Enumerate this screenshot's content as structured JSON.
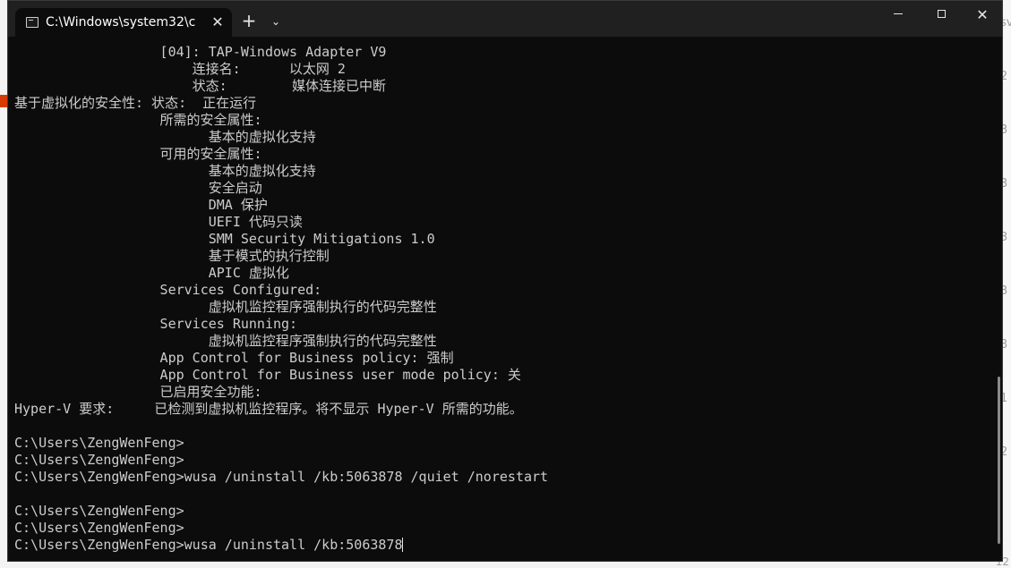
{
  "background": {
    "right_glyphs": [
      "sv",
      "2",
      "3",
      "3",
      "3",
      "3",
      "3",
      "1",
      "2"
    ],
    "corner_number": "12"
  },
  "window": {
    "tab_title": "C:\\Windows\\system32\\c",
    "tab_close": "✕",
    "new_tab": "+",
    "tab_dropdown": "⌄",
    "close": "✕"
  },
  "console": {
    "lines": [
      "                  [04]: TAP-Windows Adapter V9",
      "                      连接名:      以太网 2",
      "                      状态:        媒体连接已中断",
      "基于虚拟化的安全性: 状态:  正在运行",
      "                  所需的安全属性:",
      "                        基本的虚拟化支持",
      "                  可用的安全属性:",
      "                        基本的虚拟化支持",
      "                        安全启动",
      "                        DMA 保护",
      "                        UEFI 代码只读",
      "                        SMM Security Mitigations 1.0",
      "                        基于模式的执行控制",
      "                        APIC 虚拟化",
      "                  Services Configured:",
      "                        虚拟机监控程序强制执行的代码完整性",
      "                  Services Running:",
      "                        虚拟机监控程序强制执行的代码完整性",
      "                  App Control for Business policy: 强制",
      "                  App Control for Business user mode policy: 关",
      "                  已启用安全功能:",
      "Hyper-V 要求:     已检测到虚拟机监控程序。将不显示 Hyper-V 所需的功能。",
      "",
      "C:\\Users\\ZengWenFeng>",
      "C:\\Users\\ZengWenFeng>",
      "C:\\Users\\ZengWenFeng>wusa /uninstall /kb:5063878 /quiet /norestart",
      "",
      "C:\\Users\\ZengWenFeng>",
      "C:\\Users\\ZengWenFeng>",
      "C:\\Users\\ZengWenFeng>wusa /uninstall /kb:5063878"
    ]
  }
}
